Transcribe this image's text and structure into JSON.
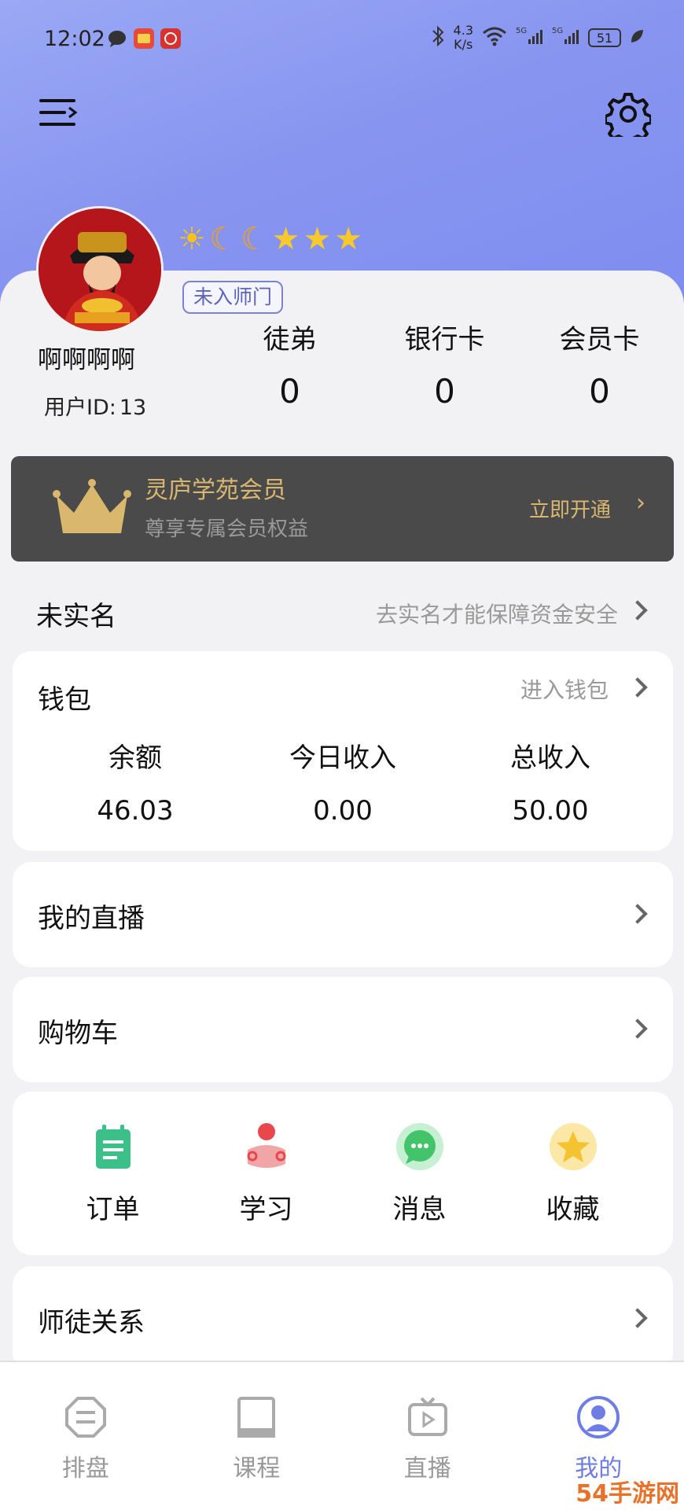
{
  "statusbar": {
    "time": "12:02",
    "net_speed_value": "4.3",
    "net_speed_unit": "K/s",
    "battery": "51",
    "icons": [
      "message-icon",
      "app-icon",
      "app-icon",
      "bluetooth-icon",
      "wifi-icon",
      "signal-5g-icon",
      "signal-5g-icon",
      "battery-icon",
      "leaf-icon"
    ]
  },
  "header": {
    "menu_icon": "menu-icon",
    "settings_icon": "gear-icon"
  },
  "profile": {
    "username": "啊啊啊啊",
    "user_id_label": "用户ID:",
    "user_id": "13",
    "tag": "未入师门",
    "badges": [
      "sun",
      "moon",
      "moon",
      "star",
      "star",
      "star"
    ],
    "stats": [
      {
        "label": "徒弟",
        "value": "0"
      },
      {
        "label": "银行卡",
        "value": "0"
      },
      {
        "label": "会员卡",
        "value": "0"
      }
    ]
  },
  "vip": {
    "title": "灵庐学苑会员",
    "subtitle": "尊享专属会员权益",
    "action": "立即开通",
    "arrow": "›"
  },
  "realname": {
    "title": "未实名",
    "hint": "去实名才能保障资金安全"
  },
  "wallet": {
    "title": "钱包",
    "enter": "进入钱包",
    "columns": [
      {
        "label": "余额",
        "value": "46.03"
      },
      {
        "label": "今日收入",
        "value": "0.00"
      },
      {
        "label": "总收入",
        "value": "50.00"
      }
    ]
  },
  "rows": {
    "live": "我的直播",
    "cart": "购物车",
    "mentor": "师徒关系"
  },
  "shortcuts": [
    {
      "label": "订单",
      "icon": "order-icon",
      "color": "#3dbf8a"
    },
    {
      "label": "学习",
      "icon": "study-icon",
      "color": "#e8474c"
    },
    {
      "label": "消息",
      "icon": "message-icon",
      "color": "#44c46a"
    },
    {
      "label": "收藏",
      "icon": "star-icon",
      "color": "#f5c330"
    }
  ],
  "bottom_nav": [
    {
      "label": "排盘",
      "icon": "chart-icon",
      "active": false
    },
    {
      "label": "课程",
      "icon": "book-icon",
      "active": false
    },
    {
      "label": "直播",
      "icon": "tv-icon",
      "active": false
    },
    {
      "label": "我的",
      "icon": "user-icon",
      "active": true
    }
  ],
  "watermark": "54手游网",
  "colors": {
    "header_gradient_start": "#9aa8f5",
    "header_gradient_end": "#7d8cf0",
    "vip_bg": "#4a4a4a",
    "vip_gold": "#d8b770",
    "active_nav": "#6e7ce6"
  }
}
